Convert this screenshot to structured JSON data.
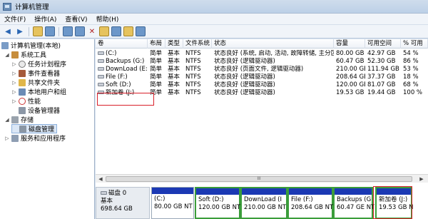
{
  "window": {
    "title": "计算机管理"
  },
  "menu": [
    "文件(F)",
    "操作(A)",
    "查看(V)",
    "帮助(H)"
  ],
  "toolbar": [
    "back-icon",
    "forward-icon",
    "up-folder-icon",
    "show-hide-tree-icon",
    "help-icon",
    "properties-icon",
    "delete-icon",
    "open-icon",
    "search-icon",
    "refresh-icon"
  ],
  "tree": [
    {
      "label": "计算机管理(本地)",
      "level": 0,
      "toggle": "",
      "icon": "computer-icon"
    },
    {
      "label": "系统工具",
      "level": 1,
      "toggle": "◢",
      "icon": "tools-icon"
    },
    {
      "label": "任务计划程序",
      "level": 2,
      "toggle": "▷",
      "icon": "clock-icon"
    },
    {
      "label": "事件查看器",
      "level": 2,
      "toggle": "▷",
      "icon": "event-viewer-icon"
    },
    {
      "label": "共享文件夹",
      "level": 2,
      "toggle": "▷",
      "icon": "shared-folder-icon"
    },
    {
      "label": "本地用户和组",
      "level": 2,
      "toggle": "▷",
      "icon": "users-icon"
    },
    {
      "label": "性能",
      "level": 2,
      "toggle": "▷",
      "icon": "performance-icon"
    },
    {
      "label": "设备管理器",
      "level": 2,
      "toggle": "",
      "icon": "device-manager-icon"
    },
    {
      "label": "存储",
      "level": 1,
      "toggle": "◢",
      "icon": "storage-icon"
    },
    {
      "label": "磁盘管理",
      "level": 2,
      "toggle": "",
      "icon": "disk-management-icon",
      "selected": true
    },
    {
      "label": "服务和应用程序",
      "level": 1,
      "toggle": "▷",
      "icon": "services-icon"
    }
  ],
  "table": {
    "columns": [
      "卷",
      "布局",
      "类型",
      "文件系统",
      "状态",
      "容量",
      "可用空间",
      "% 可用"
    ],
    "rows": [
      [
        "(C:)",
        "简单",
        "基本",
        "NTFS",
        "状态良好 (系统, 启动, 活动, 故障转储, 主分区)",
        "80.00 GB",
        "42.97 GB",
        "54 %"
      ],
      [
        "Backups (G:)",
        "简单",
        "基本",
        "NTFS",
        "状态良好 (逻辑驱动器)",
        "60.47 GB",
        "52.30 GB",
        "86 %"
      ],
      [
        "DownLoad (E:)",
        "简单",
        "基本",
        "NTFS",
        "状态良好 (页面文件, 逻辑驱动器)",
        "210.00 GB",
        "111.94 GB",
        "53 %"
      ],
      [
        "File (F:)",
        "简单",
        "基本",
        "NTFS",
        "状态良好 (逻辑驱动器)",
        "208.64 GB",
        "37.37 GB",
        "18 %"
      ],
      [
        "Soft (D:)",
        "简单",
        "基本",
        "NTFS",
        "状态良好 (逻辑驱动器)",
        "120.00 GB",
        "81.07 GB",
        "68 %"
      ],
      [
        "新加卷 (J:)",
        "简单",
        "基本",
        "NTFS",
        "状态良好 (逻辑驱动器)",
        "19.53 GB",
        "19.44 GB",
        "100 %"
      ]
    ]
  },
  "scroll_glyph": "III",
  "disk": {
    "name": "磁盘 0",
    "type": "基本",
    "size": "698.64 GB",
    "partitions": [
      {
        "name": "(C:)",
        "size": "80.00 GB NT"
      },
      {
        "name": "Soft  (D:)",
        "size": "120.00 GB NT"
      },
      {
        "name": "DownLoad  (I",
        "size": "210.00 GB NT"
      },
      {
        "name": "File  (F:)",
        "size": "208.64 GB NTI"
      },
      {
        "name": "Backups  (G",
        "size": "60.47 GE NT"
      },
      {
        "name": "新加卷  (J:)",
        "size": "19.53 GB N"
      }
    ]
  },
  "colors": {
    "partition_bar": "#1b39b4",
    "extended_border": "#3b9d3b",
    "highlight": "#d9202a"
  }
}
